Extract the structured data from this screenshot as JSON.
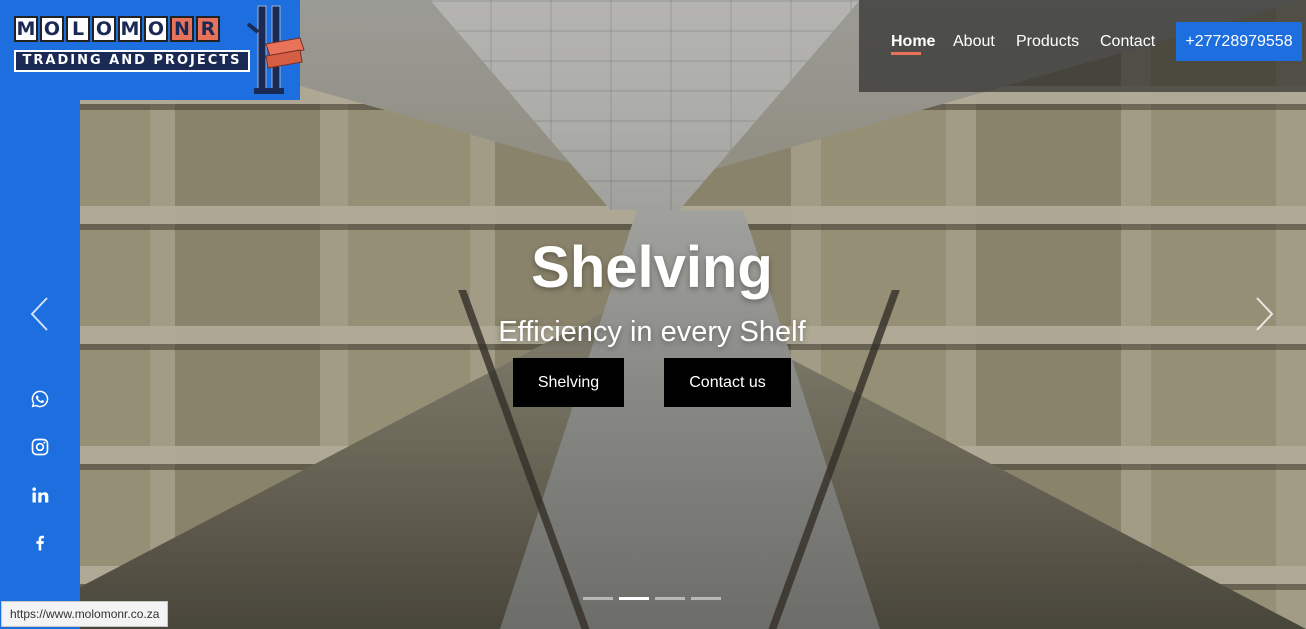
{
  "logo": {
    "letters": [
      "M",
      "O",
      "L",
      "O",
      "M",
      "O",
      "N",
      "R"
    ],
    "subtitle": "TRADING AND PROJECTS"
  },
  "nav": {
    "items": [
      {
        "label": "Home",
        "active": true
      },
      {
        "label": "About",
        "active": false
      },
      {
        "label": "Products",
        "active": false
      },
      {
        "label": "Contact",
        "active": false
      }
    ],
    "phone": "+27728979558"
  },
  "hero": {
    "title": "Shelving",
    "subtitle": "Efficiency in every Shelf",
    "buttons": [
      "Shelving",
      "Contact us"
    ]
  },
  "carousel": {
    "slide_count": 4,
    "active_index": 1,
    "prev_icon": "chevron-left-icon",
    "next_icon": "chevron-right-icon"
  },
  "social": [
    "whatsapp-icon",
    "instagram-icon",
    "linkedin-icon",
    "facebook-icon"
  ],
  "status_bar": {
    "url": "https://www.molomonr.co.za"
  },
  "colors": {
    "rail_blue": "#1d6fe0",
    "accent_orange": "#e8735a",
    "button_black": "#000000"
  }
}
